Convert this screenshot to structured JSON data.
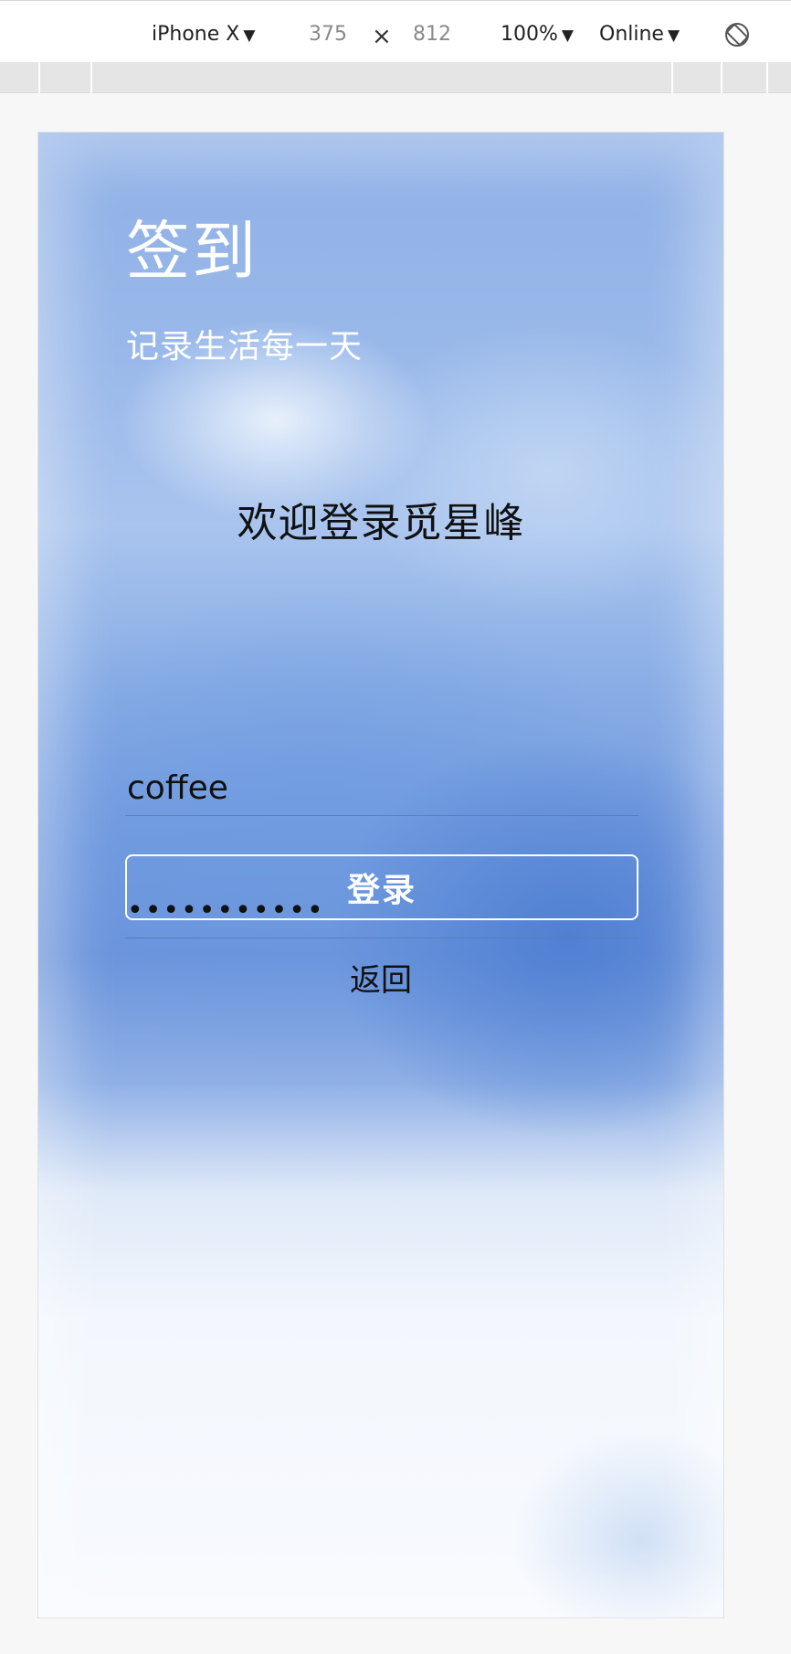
{
  "devtools": {
    "device": "iPhone X",
    "width": "375",
    "times": "×",
    "height": "812",
    "zoom": "100%",
    "network": "Online",
    "caret": "▼",
    "rotate_icon": "rotate-icon"
  },
  "app": {
    "title": "签到",
    "subtitle": "记录生活每一天",
    "welcome": "欢迎登录觅星峰",
    "username_value": "coffee",
    "password_value": "•••••••••••",
    "login_label": "登录",
    "back_label": "返回"
  },
  "colors": {
    "accent_blue": "#6a93db",
    "text_dark": "#111111",
    "text_light": "#ffffff"
  }
}
